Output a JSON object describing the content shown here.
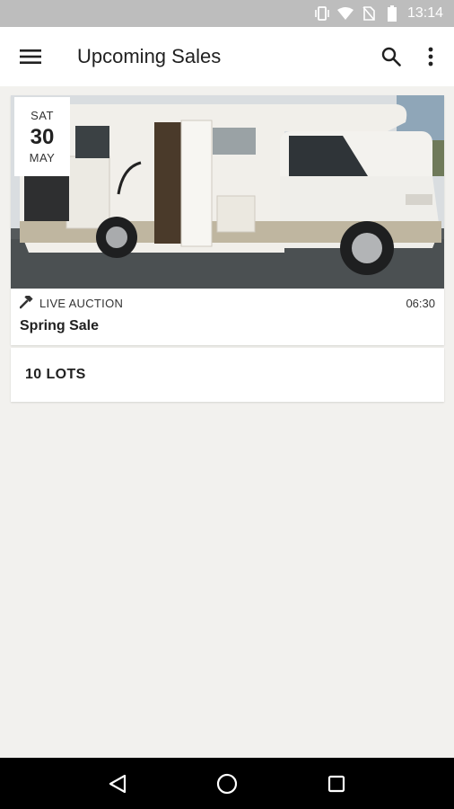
{
  "status_bar": {
    "time": "13:14"
  },
  "app_bar": {
    "title": "Upcoming Sales"
  },
  "sale": {
    "date": {
      "day_of_week": "SAT",
      "day": "30",
      "month": "MAY"
    },
    "type": "LIVE AUCTION",
    "time": "06:30",
    "title": "Spring Sale",
    "lots": "10 LOTS"
  },
  "icons": {
    "menu": "menu-icon",
    "search": "search-icon",
    "more": "more-vert-icon",
    "gavel": "gavel-icon",
    "back": "back-icon",
    "home": "home-icon",
    "recents": "recents-icon"
  },
  "colors": {
    "status_bar": "#bdbdbd",
    "app_bar": "#ffffff",
    "background": "#f2f1ee",
    "nav_bar": "#000000"
  }
}
